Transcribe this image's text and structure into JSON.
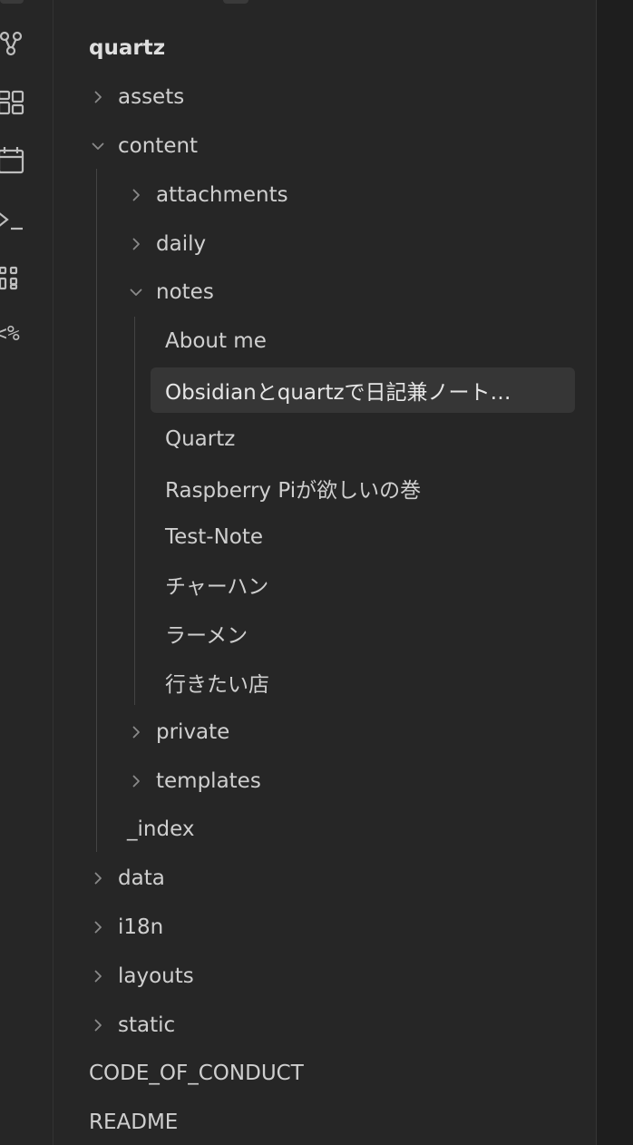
{
  "ribbon": {
    "icons": [
      "graph-icon",
      "canvas-icon",
      "calendar-icon",
      "terminal-icon",
      "blocks-icon"
    ],
    "templater_glyph": "<%"
  },
  "explorer": {
    "root": "quartz",
    "items": [
      {
        "label": "assets",
        "type": "folder",
        "expanded": false
      },
      {
        "label": "content",
        "type": "folder",
        "expanded": true
      },
      {
        "label": "attachments",
        "type": "folder",
        "expanded": false
      },
      {
        "label": "daily",
        "type": "folder",
        "expanded": false
      },
      {
        "label": "notes",
        "type": "folder",
        "expanded": true
      },
      {
        "label": "About me",
        "type": "file"
      },
      {
        "label": "Obsidianとquartzで日記兼ノート…",
        "type": "file",
        "selected": true
      },
      {
        "label": "Quartz",
        "type": "file"
      },
      {
        "label": "Raspberry Piが欲しいの巻",
        "type": "file"
      },
      {
        "label": "Test-Note",
        "type": "file"
      },
      {
        "label": "チャーハン",
        "type": "file"
      },
      {
        "label": "ラーメン",
        "type": "file"
      },
      {
        "label": "行きたい店",
        "type": "file"
      },
      {
        "label": "private",
        "type": "folder",
        "expanded": false
      },
      {
        "label": "templates",
        "type": "folder",
        "expanded": false
      },
      {
        "label": "_index",
        "type": "file"
      },
      {
        "label": "data",
        "type": "folder",
        "expanded": false
      },
      {
        "label": "i18n",
        "type": "folder",
        "expanded": false
      },
      {
        "label": "layouts",
        "type": "folder",
        "expanded": false
      },
      {
        "label": "static",
        "type": "folder",
        "expanded": false
      },
      {
        "label": "CODE_OF_CONDUCT",
        "type": "file"
      },
      {
        "label": "README",
        "type": "file"
      }
    ]
  },
  "colors": {
    "background": "#262626",
    "text": "#cfcfcf",
    "selection": "#363636",
    "guide": "#444444"
  }
}
